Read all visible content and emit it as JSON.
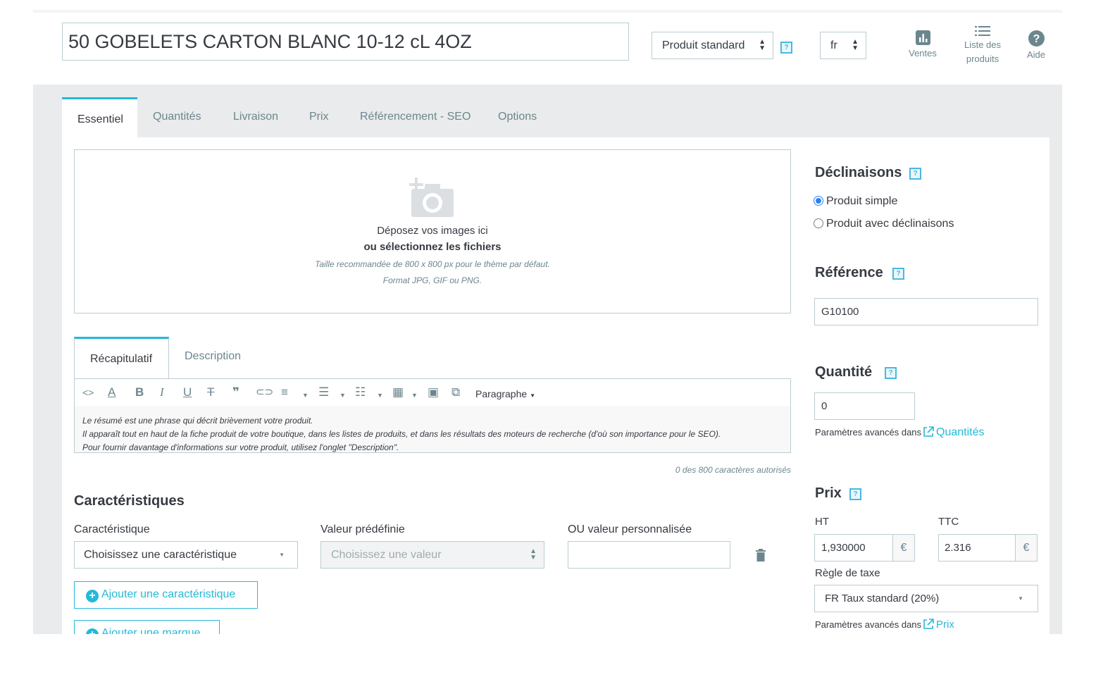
{
  "header": {
    "product_name": "50 GOBELETS CARTON BLANC 10-12 cL 4OZ",
    "product_type": "Produit standard",
    "language": "fr",
    "help_icon": "?",
    "buttons": [
      {
        "label": "Ventes",
        "icon": "bar-chart-icon"
      },
      {
        "label": "Liste des\nproduits",
        "label_line1": "Liste des",
        "label_line2": "produits",
        "icon": "list-icon"
      },
      {
        "label": "Aide",
        "icon": "help-circle-icon"
      }
    ]
  },
  "tabs": [
    "Essentiel",
    "Quantités",
    "Livraison",
    "Prix",
    "Référencement - SEO",
    "Options"
  ],
  "active_tab": "Essentiel",
  "dropzone": {
    "line1": "Déposez vos images ici",
    "line2": "ou sélectionnez les fichiers",
    "line3": "Taille recommandée de 800 x 800 px pour le thème par défaut.",
    "line4": "Format JPG, GIF ou PNG."
  },
  "editor": {
    "tabs": [
      "Récapitulatif",
      "Description"
    ],
    "format_label": "Paragraphe",
    "placeholder_lines": [
      "Le résumé est une phrase qui décrit brièvement votre produit.",
      "Il apparaît tout en haut de la fiche produit de votre boutique, dans les listes de produits, et dans les résultats des moteurs de recherche (d'où son importance pour le SEO).",
      "Pour fournir davantage d'informations sur votre produit, utilisez l'onglet \"Description\"."
    ],
    "char_count": "0 des 800 caractères autorisés"
  },
  "features": {
    "title": "Caractéristiques",
    "col1_label": "Caractéristique",
    "col1_value": "Choisissez une caractéristique",
    "col2_label": "Valeur prédéfinie",
    "col2_value": "Choisissez une valeur",
    "col3_label": "OU valeur personnalisée",
    "col3_value": "",
    "add_feature": "Ajouter une caractéristique",
    "add_brand": "Ajouter une marque"
  },
  "sidebar": {
    "declinaisons_title": "Déclinaisons",
    "radio_simple": "Produit simple",
    "radio_combinations": "Produit avec déclinaisons",
    "reference_title": "Référence",
    "reference_value": "G10100",
    "quantity_title": "Quantité",
    "quantity_value": "0",
    "advanced_in": "Paramètres avancés dans",
    "quantity_link": "Quantités",
    "price_title": "Prix",
    "ht_label": "HT",
    "ht_value": "1,930000",
    "ttc_label": "TTC",
    "ttc_value": "2.316",
    "currency": "€",
    "tax_rule_label": "Règle de taxe",
    "tax_rule_value": "FR Taux standard (20%)",
    "price_link": "Prix"
  },
  "colors": {
    "accent": "#25b9d7",
    "text": "#363a41",
    "muted": "#6c868e",
    "border": "#bbcdd2",
    "band": "#eaebec"
  }
}
